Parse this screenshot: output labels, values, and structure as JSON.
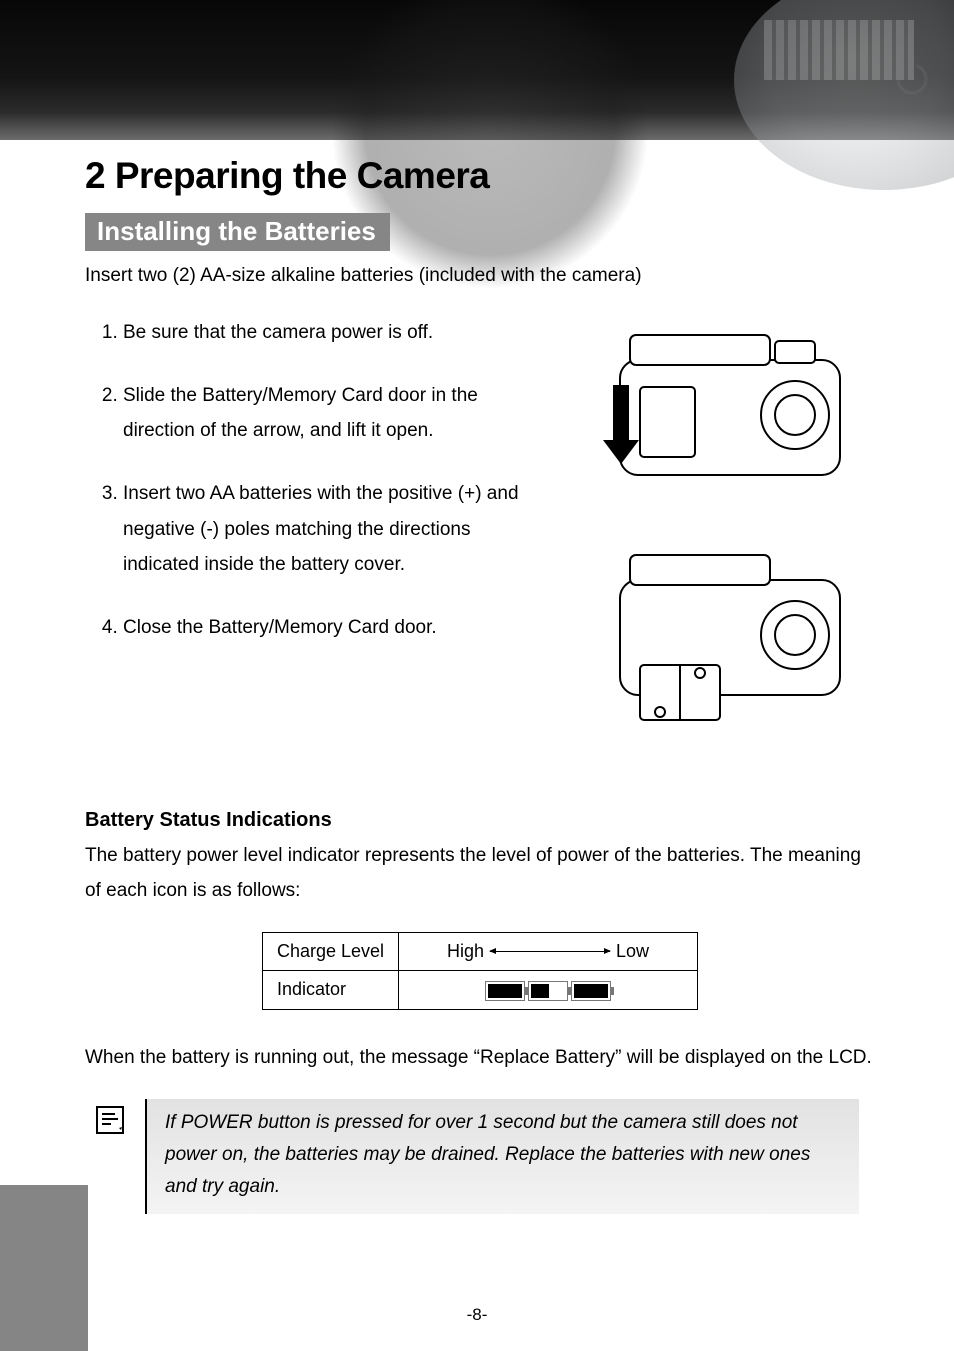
{
  "page_number": "-8-",
  "heading": "2 Preparing the Camera",
  "subheading": "Installing the Batteries",
  "intro": "Insert two (2) AA-size alkaline batteries (included with the camera)",
  "steps": [
    "Be sure that the camera power is off.",
    "Slide the Battery/Memory Card door in the direction of the arrow, and lift it open.",
    "Insert two AA batteries with the positive (+) and negative (-) poles matching the directions indicated inside the battery cover.",
    "Close the Battery/Memory Card door."
  ],
  "battery_section_title": "Battery Status Indications",
  "battery_section_body": "The battery power level indicator represents the level of power of the batteries. The meaning of each icon is as follows:",
  "table": {
    "row1_label": "Charge Level",
    "row1_high": "High",
    "row1_low": "Low",
    "row2_label": "Indicator"
  },
  "after_table": "When the battery is running out, the message “Replace Battery” will be displayed on the LCD.",
  "note": "If POWER button is pressed for over 1 second but the camera still does not power on, the batteries may be drained. Replace the batteries with new ones and try again."
}
